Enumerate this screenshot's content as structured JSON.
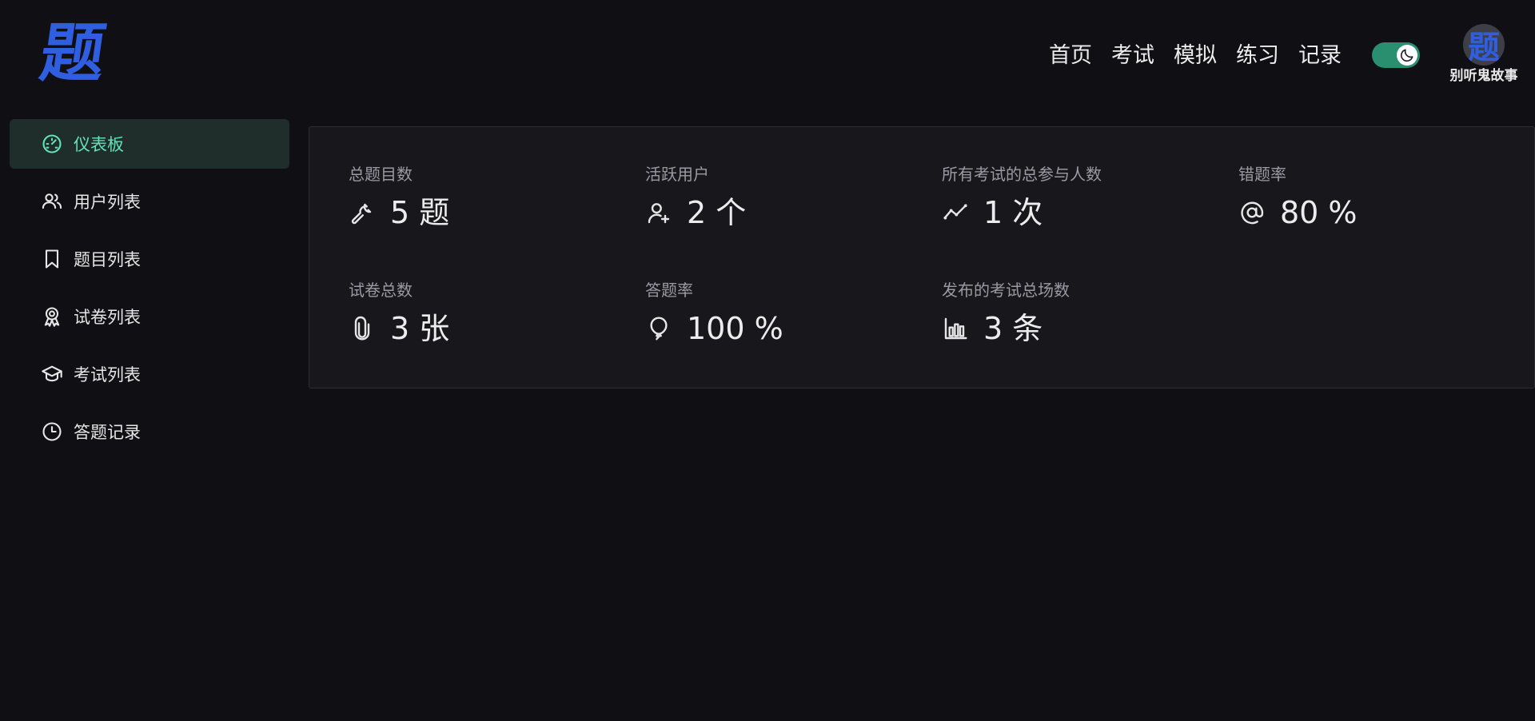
{
  "header": {
    "logo_text": "题",
    "nav": [
      "首页",
      "考试",
      "模拟",
      "练习",
      "记录"
    ],
    "theme_toggle": "dark",
    "user": {
      "avatar_text": "题",
      "name": "别听鬼故事"
    }
  },
  "sidebar": {
    "items": [
      {
        "label": "仪表板",
        "icon": "dashboard-icon",
        "active": true
      },
      {
        "label": "用户列表",
        "icon": "users-icon",
        "active": false
      },
      {
        "label": "题目列表",
        "icon": "bookmark-icon",
        "active": false
      },
      {
        "label": "试卷列表",
        "icon": "award-icon",
        "active": false
      },
      {
        "label": "考试列表",
        "icon": "graduation-cap-icon",
        "active": false
      },
      {
        "label": "答题记录",
        "icon": "clock-icon",
        "active": false
      }
    ]
  },
  "stats": [
    {
      "label": "总题目数",
      "value": "5 题",
      "icon": "wrench-icon"
    },
    {
      "label": "活跃用户",
      "value": "2 个",
      "icon": "user-plus-icon"
    },
    {
      "label": "所有考试的总参与人数",
      "value": "1 次",
      "icon": "trend-line-icon"
    },
    {
      "label": "错题率",
      "value": "80 %",
      "icon": "at-sign-icon"
    },
    {
      "label": "试卷总数",
      "value": "3 张",
      "icon": "paperclip-icon"
    },
    {
      "label": "答题率",
      "value": "100 %",
      "icon": "balloon-icon"
    },
    {
      "label": "发布的考试总场数",
      "value": "3 条",
      "icon": "bar-chart-icon"
    }
  ],
  "colors": {
    "background": "#101014",
    "card": "#18181c",
    "accent": "#63e2b7",
    "logo": "#2f5fe0",
    "toggle": "#2a8f6e"
  }
}
